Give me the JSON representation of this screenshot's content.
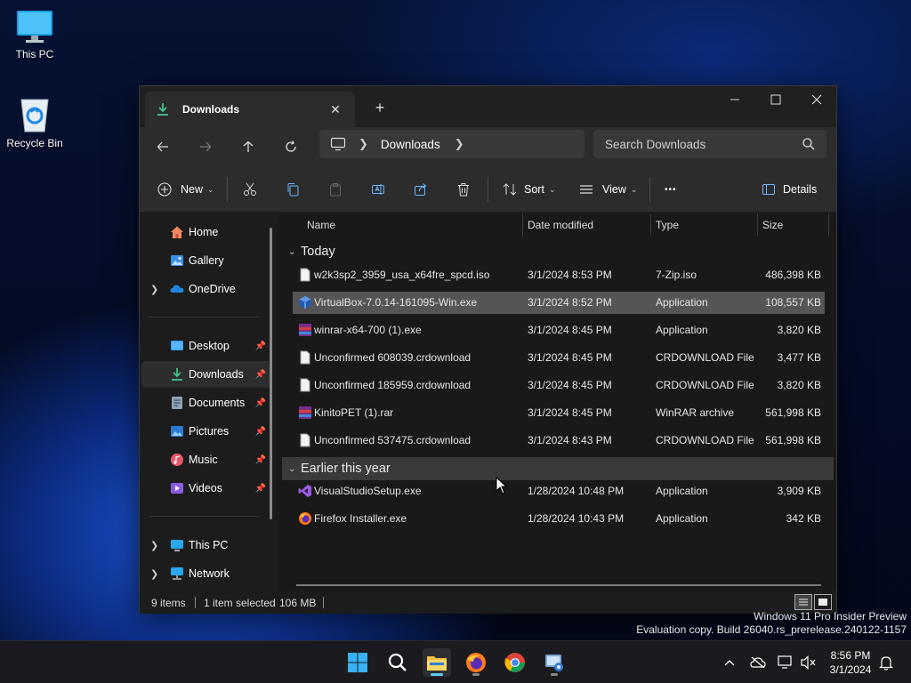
{
  "desktop": {
    "icons": [
      {
        "label": "This PC",
        "icon": "monitor-icon"
      },
      {
        "label": "Recycle Bin",
        "icon": "recycle-bin-icon"
      }
    ]
  },
  "window": {
    "tab_title": "Downloads",
    "tab_close": "✕",
    "new_tab": "+",
    "address": {
      "location": "Downloads"
    },
    "search": {
      "placeholder": "Search Downloads"
    },
    "toolbar": {
      "new_label": "New",
      "sort_label": "Sort",
      "view_label": "View",
      "more_label": "•••",
      "details_label": "Details"
    },
    "sidebar": {
      "items": [
        {
          "label": "Home",
          "icon": "home-icon"
        },
        {
          "label": "Gallery",
          "icon": "gallery-icon"
        },
        {
          "label": "OneDrive",
          "icon": "onedrive-icon"
        },
        {
          "label": "Desktop",
          "icon": "desktop-folder-icon",
          "pinned": true
        },
        {
          "label": "Downloads",
          "icon": "download-icon",
          "pinned": true,
          "active": true
        },
        {
          "label": "Documents",
          "icon": "documents-icon",
          "pinned": true
        },
        {
          "label": "Pictures",
          "icon": "pictures-icon",
          "pinned": true
        },
        {
          "label": "Music",
          "icon": "music-icon",
          "pinned": true
        },
        {
          "label": "Videos",
          "icon": "videos-icon",
          "pinned": true
        },
        {
          "label": "This PC",
          "icon": "this-pc-icon"
        },
        {
          "label": "Network",
          "icon": "network-icon"
        }
      ]
    },
    "columns": {
      "name": "Name",
      "date": "Date modified",
      "type": "Type",
      "size": "Size"
    },
    "groups": [
      {
        "title": "Today",
        "files": [
          {
            "name": "w2k3sp2_3959_usa_x64fre_spcd.iso",
            "date": "3/1/2024 8:53 PM",
            "type": "7-Zip.iso",
            "size": "486,398 KB",
            "icon": "file-icon"
          },
          {
            "name": "VirtualBox-7.0.14-161095-Win.exe",
            "date": "3/1/2024 8:52 PM",
            "type": "Application",
            "size": "108,557 KB",
            "icon": "virtualbox-icon",
            "selected": true
          },
          {
            "name": "winrar-x64-700 (1).exe",
            "date": "3/1/2024 8:45 PM",
            "type": "Application",
            "size": "3,820 KB",
            "icon": "winrar-icon"
          },
          {
            "name": "Unconfirmed 608039.crdownload",
            "date": "3/1/2024 8:45 PM",
            "type": "CRDOWNLOAD File",
            "size": "3,477 KB",
            "icon": "file-icon"
          },
          {
            "name": "Unconfirmed 185959.crdownload",
            "date": "3/1/2024 8:45 PM",
            "type": "CRDOWNLOAD File",
            "size": "3,820 KB",
            "icon": "file-icon"
          },
          {
            "name": "KinitoPET (1).rar",
            "date": "3/1/2024 8:45 PM",
            "type": "WinRAR archive",
            "size": "561,998 KB",
            "icon": "winrar-archive-icon"
          },
          {
            "name": "Unconfirmed 537475.crdownload",
            "date": "3/1/2024 8:43 PM",
            "type": "CRDOWNLOAD File",
            "size": "561,998 KB",
            "icon": "file-icon"
          }
        ]
      },
      {
        "title": "Earlier this year",
        "files": [
          {
            "name": "VisualStudioSetup.exe",
            "date": "1/28/2024 10:48 PM",
            "type": "Application",
            "size": "3,909 KB",
            "icon": "visual-studio-icon"
          },
          {
            "name": "Firefox Installer.exe",
            "date": "1/28/2024 10:43 PM",
            "type": "Application",
            "size": "342 KB",
            "icon": "firefox-icon"
          }
        ]
      }
    ],
    "status": {
      "items": "9 items",
      "selection": "1 item selected",
      "size": "106 MB"
    }
  },
  "watermark": {
    "line1": "Windows 11 Pro Insider Preview",
    "line2": "Evaluation copy. Build 26040.rs_prerelease.240122-1157"
  },
  "taskbar": {
    "apps": [
      "start-icon",
      "search-icon",
      "file-explorer-icon",
      "firefox-icon",
      "chrome-icon",
      "virtualbox-setup-icon"
    ],
    "clock": {
      "time": "8:56 PM",
      "date": "3/1/2024"
    }
  },
  "colors": {
    "accent": "#5ec8fa",
    "selected_row": "#555555",
    "window_bg": "#191919"
  }
}
